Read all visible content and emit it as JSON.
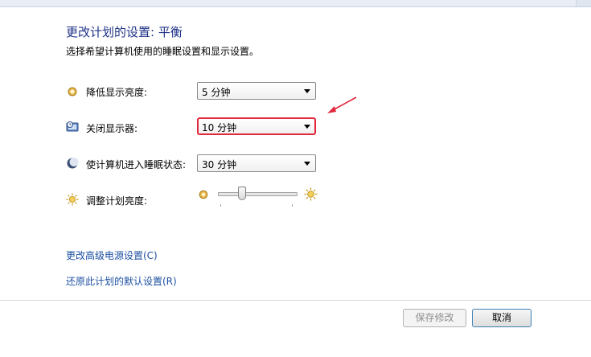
{
  "header": {
    "title": "更改计划的设置: 平衡",
    "subtitle": "选择希望计算机使用的睡眠设置和显示设置。"
  },
  "settings": [
    {
      "label": "降低显示亮度:",
      "value": "5 分钟",
      "icon": "dim-brightness-icon"
    },
    {
      "label": "关闭显示器:",
      "value": "10 分钟",
      "icon": "monitor-clock-icon"
    },
    {
      "label": "使计算机进入睡眠状态:",
      "value": "30 分钟",
      "icon": "sleep-moon-icon"
    },
    {
      "label": "调整计划亮度:",
      "icon": "brightness-sun-icon"
    }
  ],
  "brightness": {
    "level": 0.3
  },
  "links": {
    "advanced": "更改高级电源设置(C)",
    "restore": "还原此计划的默认设置(R)"
  },
  "buttons": {
    "save": "保存修改",
    "cancel": "取消"
  },
  "colors": {
    "highlight_border": "#e2283c",
    "link": "#1e50a2",
    "title": "#1e3287"
  }
}
